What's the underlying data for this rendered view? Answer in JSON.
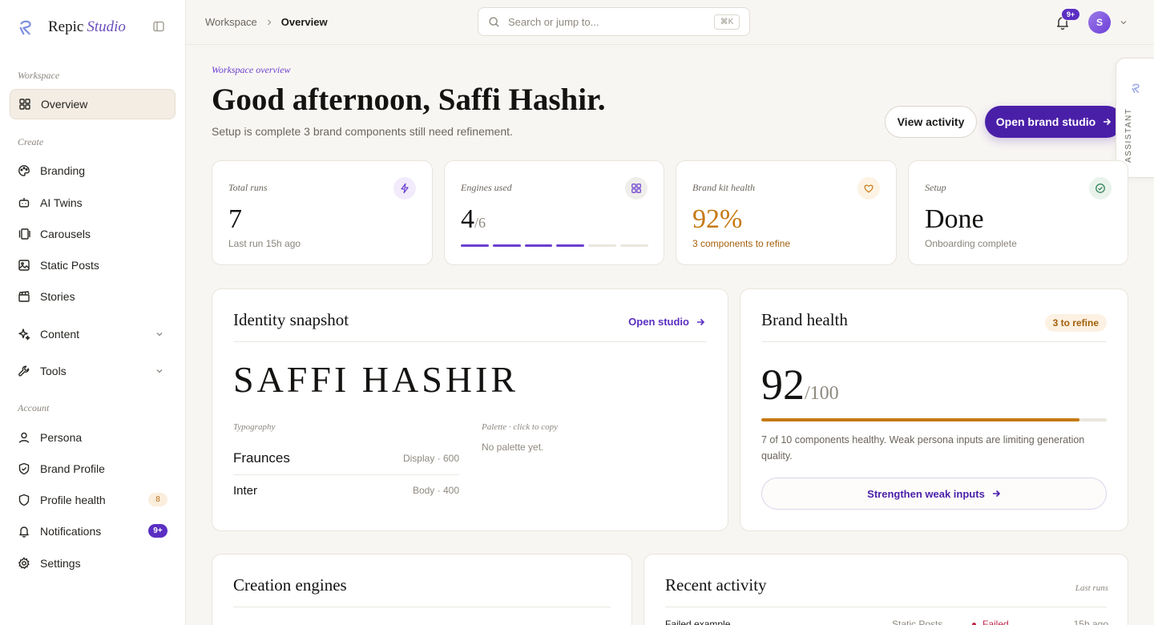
{
  "brand": {
    "name": "Repic",
    "suffix": "Studio"
  },
  "sidebar": {
    "sections": {
      "workspace": "Workspace",
      "create": "Create",
      "account": "Account"
    },
    "workspace_items": [
      {
        "label": "Overview",
        "icon": "grid-icon"
      }
    ],
    "create_items": [
      {
        "label": "Branding",
        "icon": "palette-icon"
      },
      {
        "label": "AI Twins",
        "icon": "bot-icon"
      },
      {
        "label": "Carousels",
        "icon": "carousel-icon"
      },
      {
        "label": "Static Posts",
        "icon": "image-icon"
      },
      {
        "label": "Stories",
        "icon": "clapper-icon"
      },
      {
        "label": "Content",
        "icon": "sparkle-icon"
      },
      {
        "label": "Tools",
        "icon": "wrench-icon"
      }
    ],
    "account_items": [
      {
        "label": "Persona",
        "icon": "user-icon"
      },
      {
        "label": "Brand Profile",
        "icon": "shield-check-icon"
      },
      {
        "label": "Profile health",
        "icon": "shield-icon",
        "badge": "8"
      },
      {
        "label": "Notifications",
        "icon": "bell-icon",
        "badge": "9+"
      },
      {
        "label": "Settings",
        "icon": "gear-icon"
      }
    ]
  },
  "topbar": {
    "breadcrumb": [
      "Workspace",
      "Overview"
    ],
    "search_placeholder": "Search or jump to...",
    "search_shortcut": "⌘K",
    "notif_badge": "9+",
    "avatar_initial": "S"
  },
  "hero": {
    "eyebrow": "Workspace overview",
    "greeting": "Good afternoon, Saffi Hashir.",
    "subline": "Setup is complete 3 brand components still need refinement.",
    "view_activity": "View activity",
    "open_studio": "Open brand studio"
  },
  "assistant": {
    "label": "ASSISTANT"
  },
  "stats": [
    {
      "label": "Total runs",
      "value": "7",
      "sub": "Last run 15h ago",
      "icon": "bolt-icon"
    },
    {
      "label": "Engines used",
      "value": "4",
      "value_small": "/6",
      "segments_total": 6,
      "segments_on": 4,
      "icon": "grid-icon"
    },
    {
      "label": "Brand kit health",
      "value": "92%",
      "sub": "3 components to refine",
      "icon": "heart-icon"
    },
    {
      "label": "Setup",
      "value": "Done",
      "sub": "Onboarding complete",
      "icon": "check-circle-icon"
    }
  ],
  "identity": {
    "title": "Identity snapshot",
    "link": "Open studio",
    "name": "SAFFI HASHIR",
    "typography_label": "Typography",
    "fonts": [
      {
        "name": "Fraunces",
        "meta": "Display · 600"
      },
      {
        "name": "Inter",
        "meta": "Body · 400"
      }
    ],
    "palette_label": "Palette · click to copy",
    "palette_empty": "No palette yet."
  },
  "health": {
    "title": "Brand health",
    "pill": "3 to refine",
    "score": "92",
    "score_max": "/100",
    "progress": 0.92,
    "description": "7 of 10 components healthy. Weak persona inputs are limiting generation quality.",
    "button": "Strengthen weak inputs"
  },
  "engines": {
    "title": "Creation engines"
  },
  "activity": {
    "title": "Recent activity",
    "meta": "Last runs",
    "rows": [
      {
        "name": "Failed example",
        "type": "Static Posts",
        "status": "Failed",
        "time": "15h ago"
      }
    ]
  },
  "colors": {
    "accent": "#4a1fa8",
    "amber": "#c67a12",
    "danger": "#c0264a"
  }
}
